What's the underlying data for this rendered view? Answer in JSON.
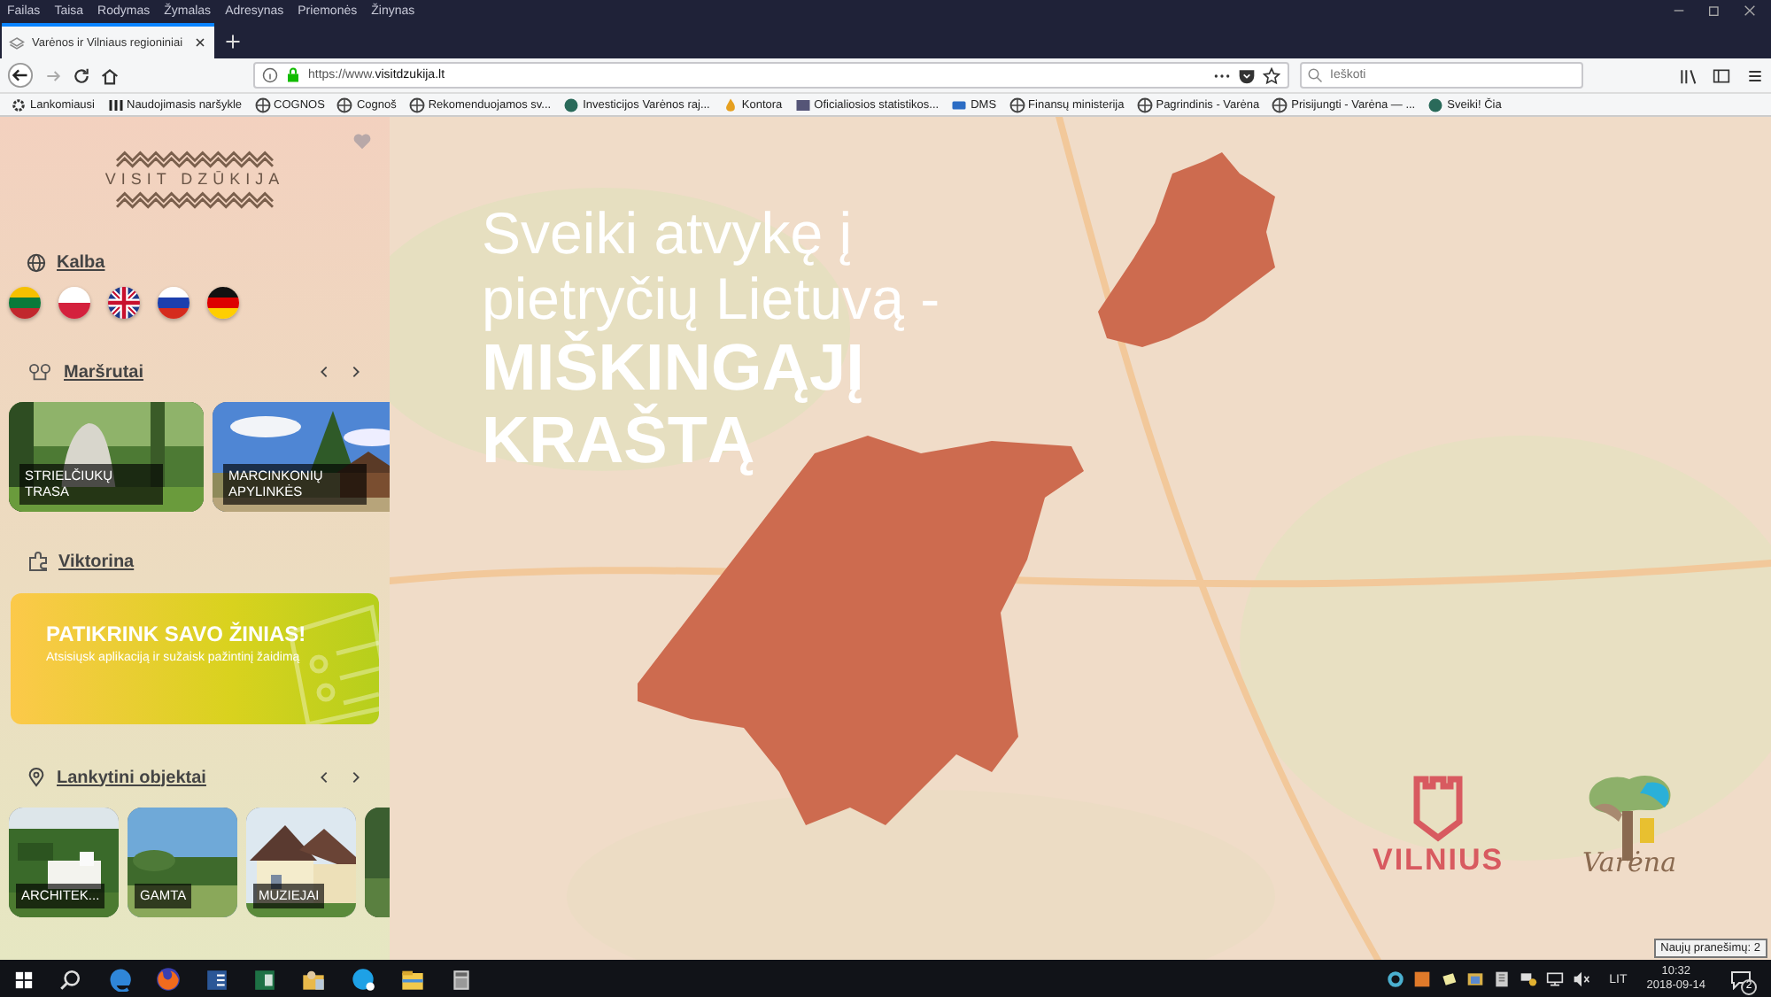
{
  "menu": [
    "Failas",
    "Taisa",
    "Rodymas",
    "Žymalas",
    "Adresynas",
    "Priemonės",
    "Žinynas"
  ],
  "tabs": [
    {
      "title": "Varėnos ir Vilniaus regioniniai",
      "selected": true
    }
  ],
  "address": {
    "url": "https://www.**visitdzukija.lt**"
  },
  "search": {
    "placeholder": "Ieškoti"
  },
  "bookmarks": [
    {
      "label": "Lankomiausi",
      "kind": "gear"
    },
    {
      "label": "Naudojimasis naršykle",
      "kind": "bars"
    },
    {
      "label": "COGNOS",
      "kind": "globe"
    },
    {
      "label": "Cognoš",
      "kind": "globe"
    },
    {
      "label": "Rekomenduojamos sv...",
      "kind": "globe"
    },
    {
      "label": "Investicijos Varėnos raj...",
      "kind": "orb"
    },
    {
      "label": "Kontora",
      "kind": "flame"
    },
    {
      "label": "Oficialiosios statistikos...",
      "kind": "chart"
    },
    {
      "label": "DMS",
      "kind": "tag"
    },
    {
      "label": "Finansų ministerija",
      "kind": "globe"
    },
    {
      "label": "Pagrindinis - Varėna",
      "kind": "globe"
    },
    {
      "label": "Prisijungti - Varėna — ...",
      "kind": "globe"
    },
    {
      "label": "Sveiki! Čia",
      "kind": "orb"
    }
  ],
  "sidebar": {
    "logo": "VISIT DZŪKIJA",
    "language": {
      "title": "Kalba",
      "flags": [
        {
          "kind": "lt"
        },
        {
          "kind": "pl"
        },
        {
          "kind": "gb"
        },
        {
          "kind": "ru"
        },
        {
          "kind": "de"
        }
      ]
    },
    "routes": {
      "title": "Maršrutai",
      "items": [
        {
          "label": "STRIELČIUKŲ TRASA"
        },
        {
          "label": "MARCINKONIŲ APYLINKĖS"
        }
      ]
    },
    "quiz": {
      "title": "Viktorina",
      "banner_title": "PATIKRINK SAVO ŽINIAS!",
      "banner_text": "Atsisiųsk aplikaciją ir sužaisk pažintinį žaidimą"
    },
    "objects": {
      "title": "Lankytini objektai",
      "items": [
        {
          "label": "ARCHITEK..."
        },
        {
          "label": "GAMTA"
        },
        {
          "label": "MUZIEJAI"
        },
        {
          "kind": "picture"
        }
      ]
    }
  },
  "hero": {
    "headline": "Sveiki atvykę į pietryčių Lietuvą - **MIŠKINGĄJĮ KRAŠTĄ**",
    "logos": {
      "vilnius": "VILNIUS",
      "varena": "Varėna"
    }
  },
  "taskbar": {
    "apps": [
      {
        "kind": "search"
      },
      {
        "kind": "edge"
      },
      {
        "kind": "fox"
      },
      {
        "kind": "word"
      },
      {
        "kind": "excel"
      },
      {
        "kind": "people"
      },
      {
        "kind": "skype"
      },
      {
        "kind": "folder"
      },
      {
        "kind": "calc"
      }
    ],
    "tray": [
      {
        "kind": "ring"
      },
      {
        "kind": "square"
      },
      {
        "kind": "note"
      },
      {
        "kind": "window"
      },
      {
        "kind": "book"
      },
      {
        "kind": "network"
      },
      {
        "kind": "monitor"
      },
      {
        "kind": "speaker"
      }
    ],
    "language": "LIT",
    "time": "10:32",
    "date": "2018-09-14",
    "notifications": "2",
    "tooltip": "Naujų pranešimų: 2"
  }
}
